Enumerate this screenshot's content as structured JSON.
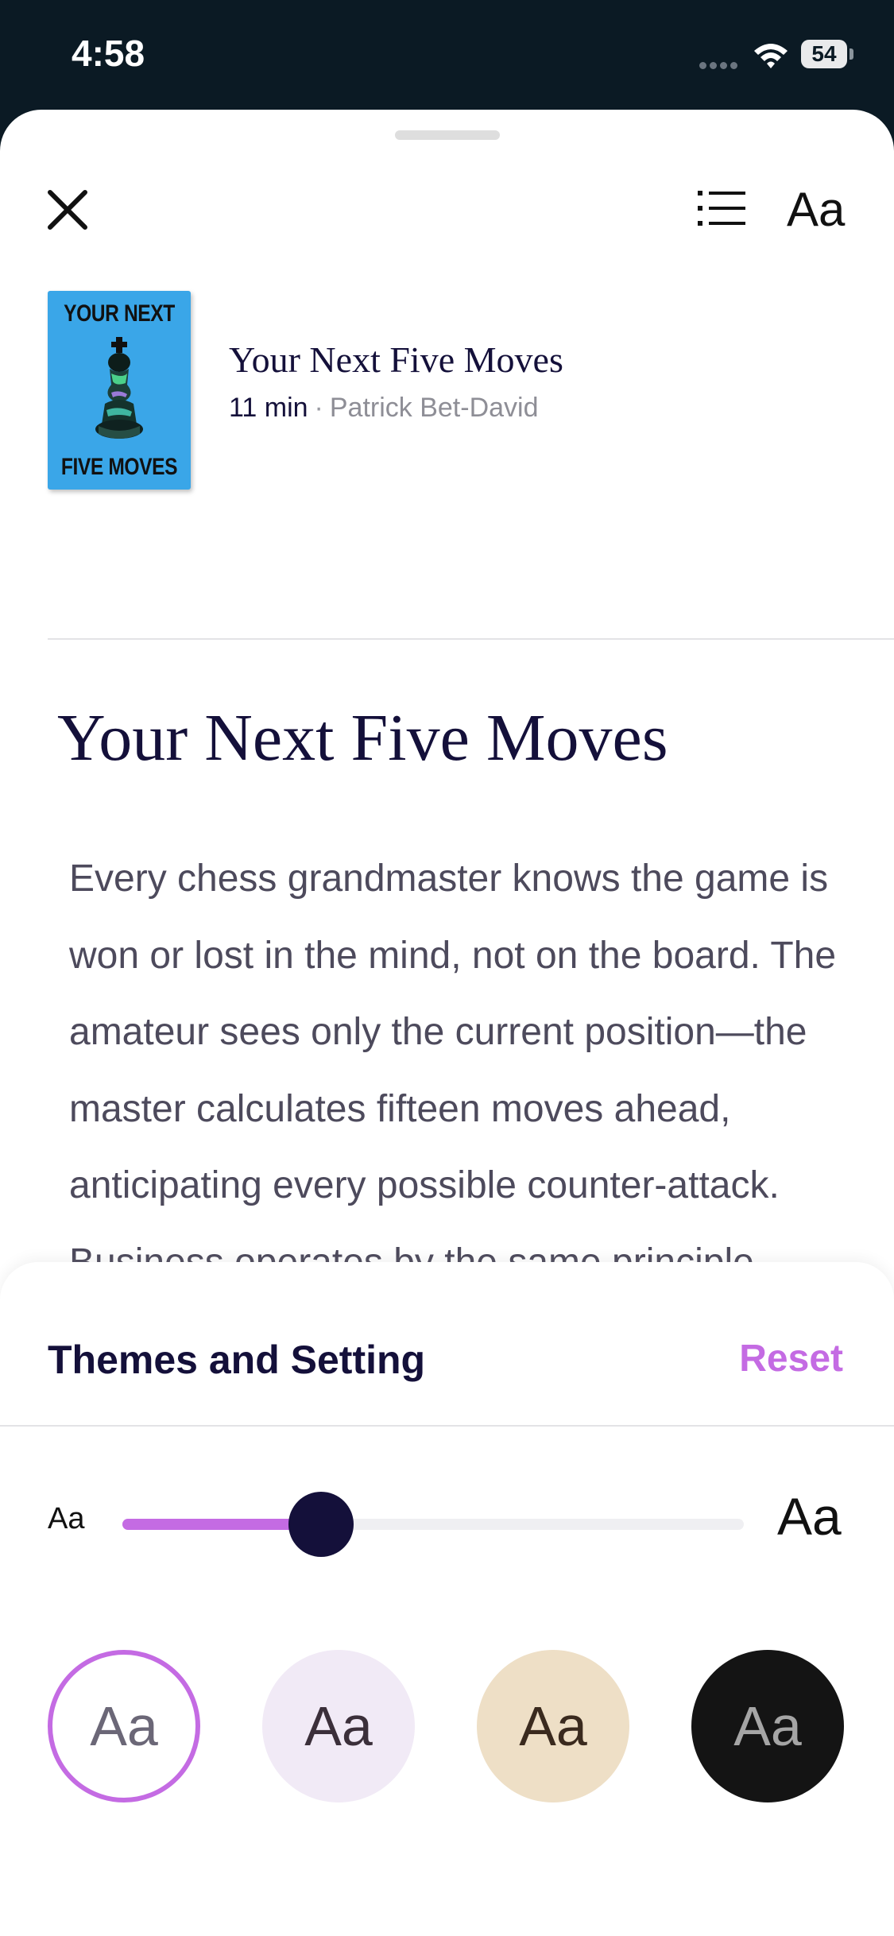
{
  "status_bar": {
    "time": "4:58",
    "battery": "54"
  },
  "toolbar": {
    "font_button_label": "Aa"
  },
  "book": {
    "cover_top": "YOUR NEXT",
    "cover_bottom": "FIVE MOVES",
    "title": "Your Next Five Moves",
    "duration": "11 min",
    "separator": "·",
    "author": "Patrick Bet-David"
  },
  "chapter": {
    "title": "Your Next Five Moves",
    "body": "Every chess grandmaster knows the game is won or lost in the mind, not on the board. The amateur sees only the current position—the master calculates fifteen moves ahead, anticipating every possible counter-attack. Business operates by the same principle. While"
  },
  "settings": {
    "title": "Themes and Setting",
    "reset_label": "Reset",
    "font_size_small_label": "Aa",
    "font_size_large_label": "Aa",
    "font_size_level": 0.32,
    "accent_color": "#c46be3",
    "themes": [
      {
        "label": "Aa",
        "name": "white",
        "selected": true
      },
      {
        "label": "Aa",
        "name": "lavender",
        "selected": false
      },
      {
        "label": "Aa",
        "name": "sepia",
        "selected": false
      },
      {
        "label": "Aa",
        "name": "dark",
        "selected": false
      }
    ]
  }
}
